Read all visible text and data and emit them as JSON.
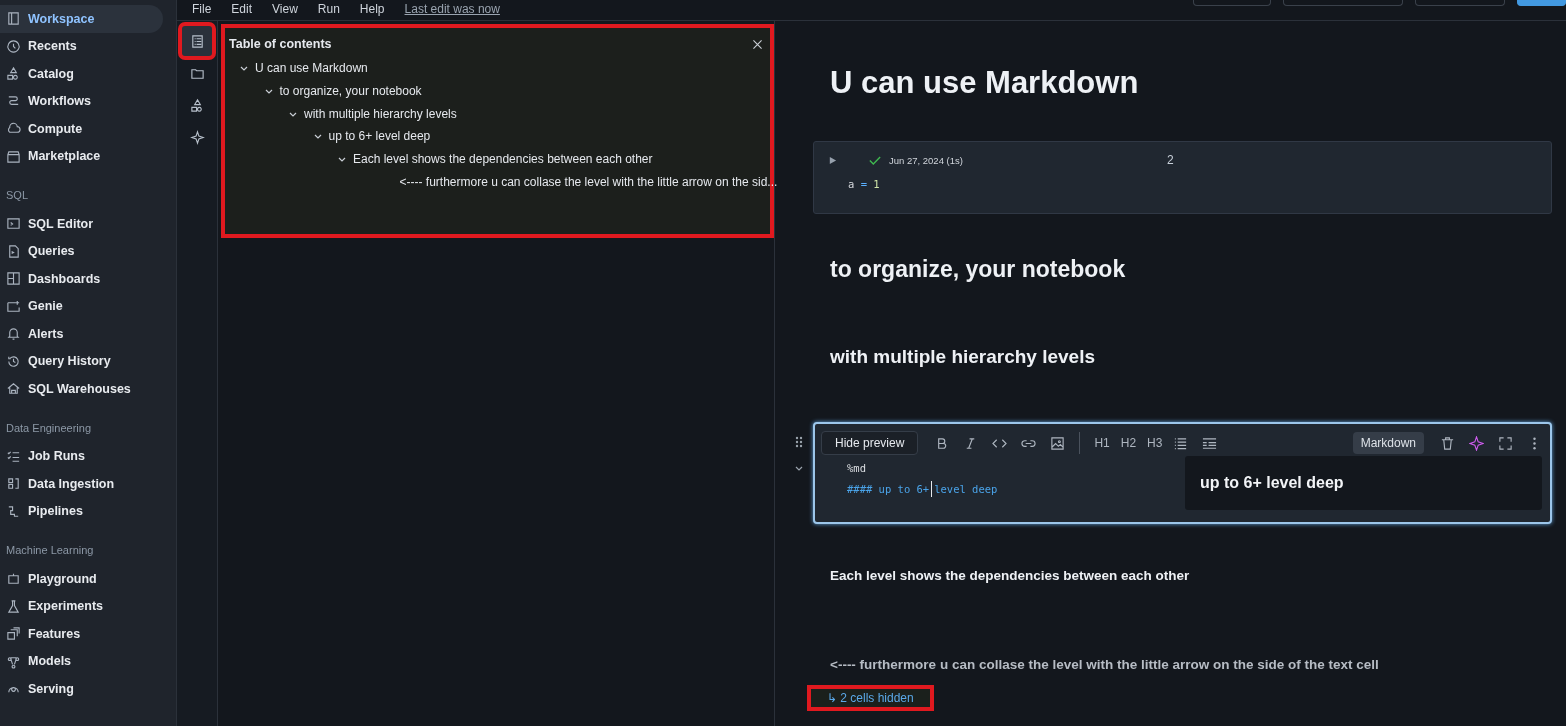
{
  "sidebar": {
    "sections": [
      {
        "items": [
          {
            "label": "Workspace",
            "selected": true
          },
          {
            "label": "Recents",
            "selected": false
          },
          {
            "label": "Catalog",
            "selected": false
          },
          {
            "label": "Workflows",
            "selected": false
          },
          {
            "label": "Compute",
            "selected": false
          },
          {
            "label": "Marketplace",
            "selected": false
          }
        ]
      },
      {
        "title": "SQL",
        "items": [
          {
            "label": "SQL Editor",
            "selected": false
          },
          {
            "label": "Queries",
            "selected": false
          },
          {
            "label": "Dashboards",
            "selected": false
          },
          {
            "label": "Genie",
            "selected": false
          },
          {
            "label": "Alerts",
            "selected": false
          },
          {
            "label": "Query History",
            "selected": false
          },
          {
            "label": "SQL Warehouses",
            "selected": false
          }
        ]
      },
      {
        "title": "Data Engineering",
        "items": [
          {
            "label": "Job Runs",
            "selected": false
          },
          {
            "label": "Data Ingestion",
            "selected": false
          },
          {
            "label": "Pipelines",
            "selected": false
          }
        ]
      },
      {
        "title": "Machine Learning",
        "items": [
          {
            "label": "Playground",
            "selected": false
          },
          {
            "label": "Experiments",
            "selected": false
          },
          {
            "label": "Features",
            "selected": false
          },
          {
            "label": "Models",
            "selected": false
          },
          {
            "label": "Serving",
            "selected": false
          }
        ]
      }
    ]
  },
  "menu": {
    "items": [
      "File",
      "Edit",
      "View",
      "Run",
      "Help"
    ],
    "last_edit": "Last edit was now"
  },
  "rail": [
    {
      "selected": true,
      "highlighted": true
    },
    {
      "selected": false,
      "highlighted": false
    },
    {
      "selected": false,
      "highlighted": false
    },
    {
      "selected": false,
      "highlighted": false
    }
  ],
  "toc": {
    "title": "Table of contents",
    "highlighted": true,
    "items": [
      {
        "label": "U can use Markdown",
        "expanded": true,
        "children": [
          {
            "label": "to organize, your notebook",
            "expanded": true,
            "children": [
              {
                "label": "with multiple hierarchy levels",
                "expanded": true,
                "children": [
                  {
                    "label": "up to 6+ level deep",
                    "expanded": true,
                    "children": [
                      {
                        "label": "Each level shows the dependencies between each other",
                        "expanded": true,
                        "children": [
                          {
                            "label": "<---- furthermore u can collase the level with the little arrow on the sid..."
                          }
                        ]
                      }
                    ]
                  }
                ]
              }
            ]
          }
        ]
      }
    ]
  },
  "cells": [
    {
      "kind": "title",
      "text": "U can use Markdown"
    },
    {
      "kind": "code",
      "status": "Jun 27, 2024 (1s)",
      "title": "2",
      "code": [
        "a",
        "=",
        "1"
      ]
    },
    {
      "kind": "heading",
      "text": "to organize, your notebook"
    },
    {
      "kind": "subheading",
      "text": "with multiple hierarchy levels"
    },
    {
      "kind": "markdown",
      "toolbar": {
        "preview_button": "Hide preview",
        "headings": [
          "H1",
          "H2",
          "H3"
        ],
        "language": "Markdown"
      },
      "source": [
        "%md",
        "#### up to 6+",
        "level deep"
      ],
      "preview": "up to 6+ level deep"
    },
    {
      "kind": "text",
      "text": "Each level shows the dependencies between each other"
    },
    {
      "kind": "note",
      "text": "<---- furthermore u can collase the level with the little arrow on the side of the text cell"
    }
  ],
  "hidden_cells": {
    "text": "↳ 2 cells hidden",
    "highlighted": true
  }
}
